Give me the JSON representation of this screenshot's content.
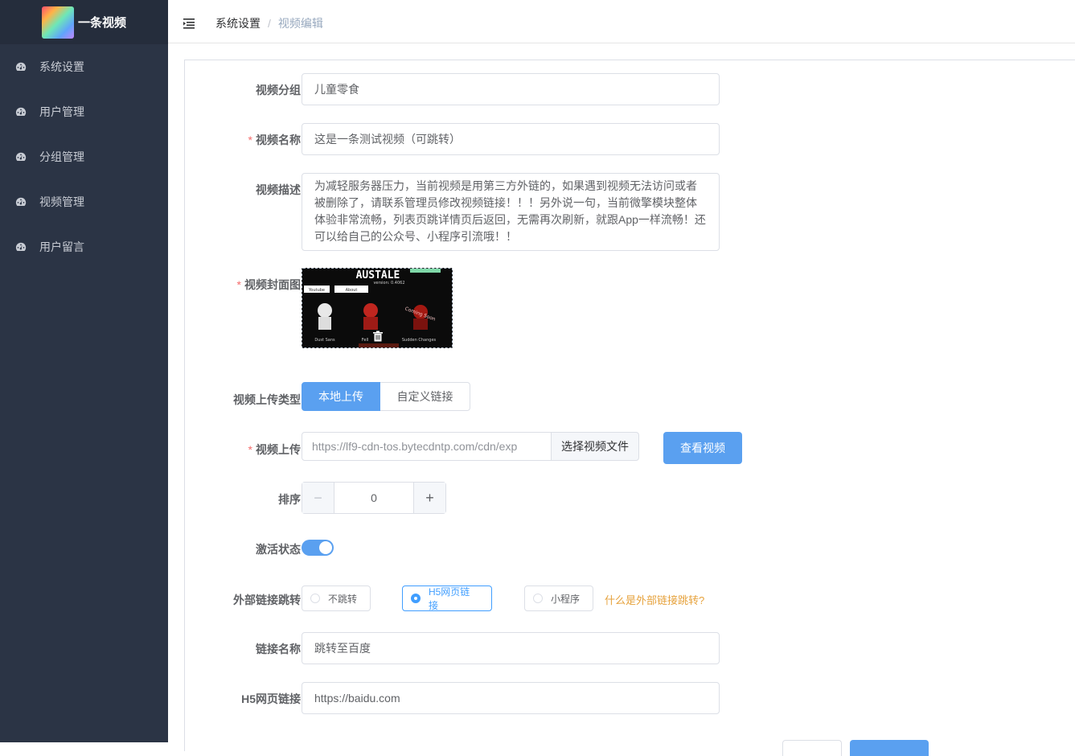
{
  "app": {
    "title": "一条视频"
  },
  "sidebar": {
    "items": [
      {
        "label": "系统设置",
        "icon": "dashboard-icon"
      },
      {
        "label": "用户管理",
        "icon": "dashboard-icon"
      },
      {
        "label": "分组管理",
        "icon": "dashboard-icon"
      },
      {
        "label": "视频管理",
        "icon": "dashboard-icon"
      },
      {
        "label": "用户留言",
        "icon": "dashboard-icon"
      }
    ]
  },
  "header": {
    "breadcrumb": {
      "parent": "系统设置",
      "separator": "/",
      "current": "视频编辑"
    }
  },
  "form": {
    "group": {
      "label": "视频分组",
      "value": "儿童零食"
    },
    "name": {
      "label": "视频名称",
      "required": "*",
      "value": "这是一条测试视频（可跳转）"
    },
    "desc": {
      "label": "视频描述",
      "value": "为减轻服务器压力，当前视频是用第三方外链的，如果遇到视频无法访问或者被删除了，请联系管理员修改视频链接！！！另外说一句，当前微擎模块整体体验非常流畅，列表页跳详情页后返回，无需再次刷新，就跟App一样流畅！还可以给自己的公众号、小程序引流哦！！"
    },
    "cover": {
      "label": "视频封面图",
      "required": "*",
      "title_text": "AUSTALE",
      "version_text": "version: 0.4062",
      "btn_youtube": "Youtube",
      "btn_about": "About",
      "caption_1": "Dust Sans",
      "caption_2": "Fell",
      "caption_3": "Sudden Changes",
      "coming_soon": "Coming Soon"
    },
    "upload_type": {
      "label": "视频上传类型",
      "options": [
        "本地上传",
        "自定义链接"
      ],
      "selected": "本地上传"
    },
    "upload": {
      "label": "视频上传",
      "required": "*",
      "value": "https://lf9-cdn-tos.bytecdntp.com/cdn/exp",
      "button": "选择视频文件",
      "view_button": "查看视频"
    },
    "sort": {
      "label": "排序",
      "value": "0",
      "minus": "−",
      "plus": "+"
    },
    "active": {
      "label": "激活状态",
      "value": true
    },
    "jump": {
      "label": "外部链接跳转",
      "options": [
        "不跳转",
        "H5网页链接",
        "小程序"
      ],
      "selected": "H5网页链接",
      "help": "什么是外部链接跳转?"
    },
    "link_name": {
      "label": "链接名称",
      "value": "跳转至百度"
    },
    "h5_link": {
      "label": "H5网页链接",
      "value": "https://baidu.com"
    }
  },
  "colors": {
    "sidebar_bg": "#2b3445",
    "primary": "#5aa0f0",
    "warning": "#e6a23c",
    "danger": "#f56c6c"
  }
}
